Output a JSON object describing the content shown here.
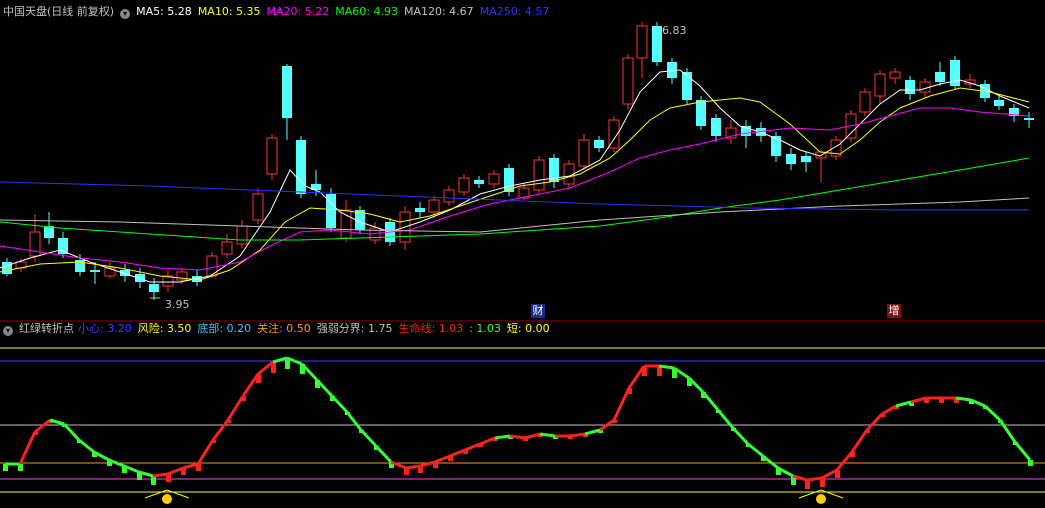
{
  "colors": {
    "background": "#000000",
    "up": "#ff3232",
    "down": "#54ffff",
    "ma5": "#ffffff",
    "ma10": "#ffff00",
    "ma20": "#ff00ff",
    "ma60": "#00ff00",
    "ma120": "#c0c0c0",
    "ma250": "#3030ff",
    "osc_up": "#ff2020",
    "osc_down": "#33ff33",
    "lvl_xiaoxin": "#4040ff",
    "lvl_fengxian": "#ffff00",
    "lvl_dibu": "#ff40ff",
    "lvl_guanzhu": "#ff9900",
    "lvl_qiangruo": "#c0c0c0",
    "lvl_shengming": "#ff2020",
    "lvl_green": "#33ff33",
    "lvl_duan": "#ffff00"
  },
  "main_panel": {
    "title": "中国天盘(日线 前复权)",
    "menu_icon": "chevron-down-icon",
    "ma": [
      {
        "label": "MA5:",
        "value": "5.28",
        "color": "#ffffff"
      },
      {
        "label": "MA10:",
        "value": "5.35",
        "color": "#ffff00"
      },
      {
        "label": "MA20:",
        "value": "5.22",
        "color": "#ff00ff"
      },
      {
        "label": "MA60:",
        "value": "4.93",
        "color": "#00ff00"
      },
      {
        "label": "MA120:",
        "value": "4.67",
        "color": "#c0c0c0"
      },
      {
        "label": "MA250:",
        "value": "4.57",
        "color": "#3030ff"
      }
    ],
    "high_label": "6.83",
    "low_label": "3.95",
    "events": [
      "财",
      "增"
    ]
  },
  "indicator_panel": {
    "title": "红绿转折点",
    "params": [
      {
        "label": "小心:",
        "value": "3.20",
        "color": "#4040ff"
      },
      {
        "label": "风险:",
        "value": "3.50",
        "color": "#ffff00"
      },
      {
        "label": "底部:",
        "value": "0.20",
        "color": "#40c0ff"
      },
      {
        "label": "关注:",
        "value": "0.50",
        "color": "#ff9900"
      },
      {
        "label": "强弱分界:",
        "value": "1.75",
        "color": "#c0c0c0"
      },
      {
        "label": "生命线:",
        "value": "1.03",
        "color": "#ff2020"
      },
      {
        "label": ":",
        "value": "1.03",
        "color": "#33ff33"
      },
      {
        "label": "短:",
        "value": "0.00",
        "color": "#ffff00"
      }
    ]
  }
}
